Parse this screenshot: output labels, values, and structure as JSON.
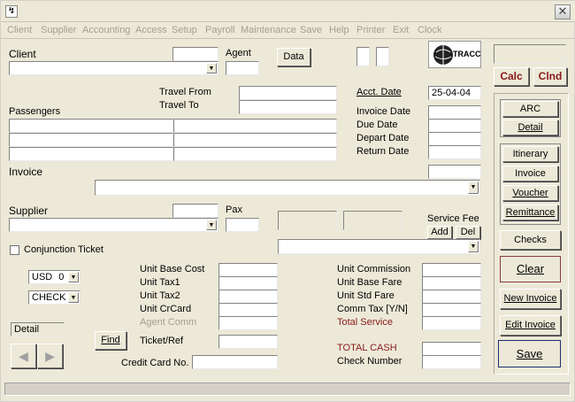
{
  "window": {
    "close_glyph": "✕",
    "app_icon_glyph": "↯"
  },
  "menu": [
    "Client",
    "Supplier",
    "Accounting",
    "Access",
    "Setup",
    "Payroll",
    "Maintenance",
    "Save",
    "Help",
    "Printer",
    "Exit",
    "Clock"
  ],
  "client": {
    "label": "Client",
    "agent_label": "Agent",
    "data_button": "Data"
  },
  "logo": {
    "text": "TRACC"
  },
  "buttons": {
    "calc": "Calc",
    "clnd": "Clnd"
  },
  "travel": {
    "from_label": "Travel From",
    "to_label": "Travel To"
  },
  "passengers": {
    "label": "Passengers"
  },
  "dates": {
    "acct_label": "Acct. Date",
    "acct_value": "25-04-04",
    "invoice_label": "Invoice Date",
    "due_label": "Due Date",
    "depart_label": "Depart Date",
    "return_label": "Return Date"
  },
  "invoice": {
    "label": "Invoice"
  },
  "supplier": {
    "label": "Supplier",
    "pax_label": "Pax",
    "service_fee_label": "Service Fee",
    "add": "Add",
    "del": "Del"
  },
  "conjunction": {
    "label": "Conjunction Ticket"
  },
  "currency": {
    "value": "USD",
    "number": "0"
  },
  "payment": {
    "value": "CHECK"
  },
  "costs": {
    "base_cost": "Unit Base Cost",
    "tax1": "Unit Tax1",
    "tax2": "Unit Tax2",
    "crcard": "Unit CrCard",
    "agent_comm": "Agent Comm",
    "ticket_ref": "Ticket/Ref",
    "credit_card": "Credit Card No.",
    "find": "Find"
  },
  "right_costs": {
    "commission": "Unit Commission",
    "base_fare": "Unit Base Fare",
    "std_fare": "Unit Std Fare",
    "comm_tax": "Comm Tax [Y/N]",
    "total_service": "Total Service",
    "total_cash": "TOTAL CASH",
    "check_number": "Check Number"
  },
  "detail": {
    "label": "Detail",
    "prev": "◀",
    "next": "▶"
  },
  "side": {
    "arc": "ARC",
    "detail": "Detail",
    "itinerary": "Itinerary",
    "invoice": "Invoice",
    "voucher": "Voucher",
    "remittance": "Remittance",
    "checks": "Checks",
    "clear": "Clear",
    "new_invoice": "New Invoice",
    "edit_invoice": "Edit Invoice",
    "save": "Save"
  },
  "colors": {
    "accent_red": "#8b1a1a",
    "focus_blue": "#1c2d6e",
    "bg": "#ece9d8"
  }
}
